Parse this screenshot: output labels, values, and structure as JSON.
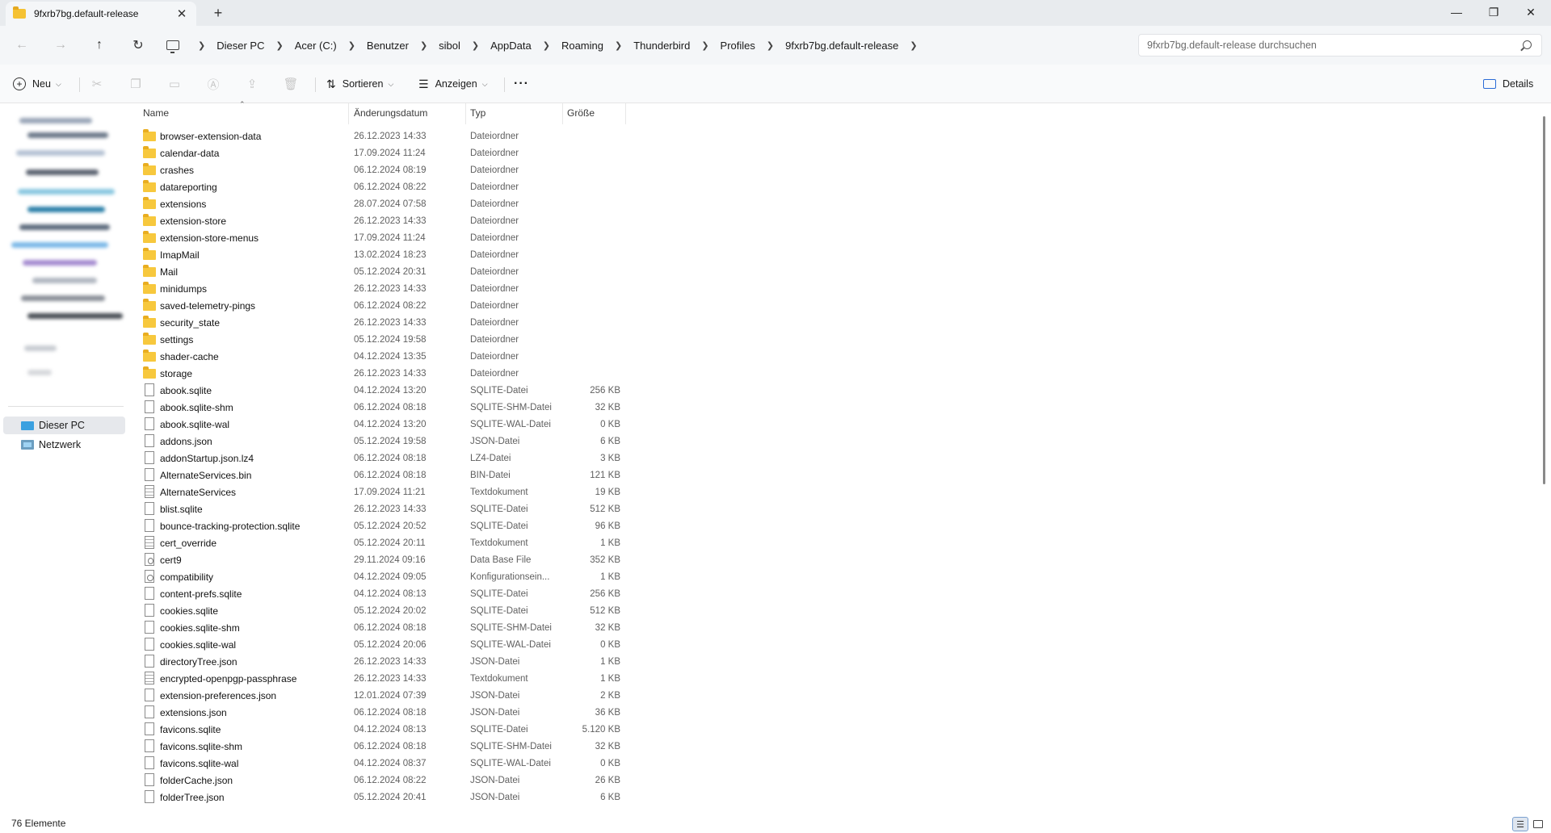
{
  "tab": {
    "title": "9fxrb7bg.default-release",
    "new_tab": "+"
  },
  "window": {
    "minimize": "—",
    "maximize": "❐",
    "close": "✕"
  },
  "nav": {
    "back": "←",
    "forward": "→",
    "up": "↑",
    "refresh": "↻"
  },
  "breadcrumbs": [
    "Dieser PC",
    "Acer (C:)",
    "Benutzer",
    "sibol",
    "AppData",
    "Roaming",
    "Thunderbird",
    "Profiles",
    "9fxrb7bg.default-release"
  ],
  "search": {
    "placeholder": "9fxrb7bg.default-release durchsuchen"
  },
  "toolbar": {
    "new_label": "Neu",
    "sort_label": "Sortieren",
    "view_label": "Anzeigen",
    "more_label": "···",
    "details_label": "Details",
    "icons": [
      "cut-icon",
      "copy-icon",
      "paste-icon",
      "rename-icon",
      "share-icon",
      "delete-icon"
    ]
  },
  "sidebar": {
    "items": [
      {
        "label": "Dieser PC",
        "icon": "computer-icon",
        "selected": true
      },
      {
        "label": "Netzwerk",
        "icon": "network-icon",
        "selected": false
      }
    ]
  },
  "columns": {
    "name": "Name",
    "date": "Änderungsdatum",
    "type": "Typ",
    "size": "Größe"
  },
  "files": [
    {
      "kind": "folder",
      "name": "browser-extension-data",
      "date": "26.12.2023 14:33",
      "type": "Dateiordner",
      "size": ""
    },
    {
      "kind": "folder",
      "name": "calendar-data",
      "date": "17.09.2024 11:24",
      "type": "Dateiordner",
      "size": ""
    },
    {
      "kind": "folder",
      "name": "crashes",
      "date": "06.12.2024 08:19",
      "type": "Dateiordner",
      "size": ""
    },
    {
      "kind": "folder",
      "name": "datareporting",
      "date": "06.12.2024 08:22",
      "type": "Dateiordner",
      "size": ""
    },
    {
      "kind": "folder",
      "name": "extensions",
      "date": "28.07.2024 07:58",
      "type": "Dateiordner",
      "size": ""
    },
    {
      "kind": "folder",
      "name": "extension-store",
      "date": "26.12.2023 14:33",
      "type": "Dateiordner",
      "size": ""
    },
    {
      "kind": "folder",
      "name": "extension-store-menus",
      "date": "17.09.2024 11:24",
      "type": "Dateiordner",
      "size": ""
    },
    {
      "kind": "folder",
      "name": "ImapMail",
      "date": "13.02.2024 18:23",
      "type": "Dateiordner",
      "size": ""
    },
    {
      "kind": "folder",
      "name": "Mail",
      "date": "05.12.2024 20:31",
      "type": "Dateiordner",
      "size": ""
    },
    {
      "kind": "folder",
      "name": "minidumps",
      "date": "26.12.2023 14:33",
      "type": "Dateiordner",
      "size": ""
    },
    {
      "kind": "folder",
      "name": "saved-telemetry-pings",
      "date": "06.12.2024 08:22",
      "type": "Dateiordner",
      "size": ""
    },
    {
      "kind": "folder",
      "name": "security_state",
      "date": "26.12.2023 14:33",
      "type": "Dateiordner",
      "size": ""
    },
    {
      "kind": "folder",
      "name": "settings",
      "date": "05.12.2024 19:58",
      "type": "Dateiordner",
      "size": ""
    },
    {
      "kind": "folder",
      "name": "shader-cache",
      "date": "04.12.2024 13:35",
      "type": "Dateiordner",
      "size": ""
    },
    {
      "kind": "folder",
      "name": "storage",
      "date": "26.12.2023 14:33",
      "type": "Dateiordner",
      "size": ""
    },
    {
      "kind": "file",
      "name": "abook.sqlite",
      "date": "04.12.2024 13:20",
      "type": "SQLITE-Datei",
      "size": "256 KB"
    },
    {
      "kind": "file",
      "name": "abook.sqlite-shm",
      "date": "06.12.2024 08:18",
      "type": "SQLITE-SHM-Datei",
      "size": "32 KB"
    },
    {
      "kind": "file",
      "name": "abook.sqlite-wal",
      "date": "04.12.2024 13:20",
      "type": "SQLITE-WAL-Datei",
      "size": "0 KB"
    },
    {
      "kind": "file",
      "name": "addons.json",
      "date": "05.12.2024 19:58",
      "type": "JSON-Datei",
      "size": "6 KB"
    },
    {
      "kind": "file",
      "name": "addonStartup.json.lz4",
      "date": "06.12.2024 08:18",
      "type": "LZ4-Datei",
      "size": "3 KB"
    },
    {
      "kind": "file",
      "name": "AlternateServices.bin",
      "date": "06.12.2024 08:18",
      "type": "BIN-Datei",
      "size": "121 KB"
    },
    {
      "kind": "text",
      "name": "AlternateServices",
      "date": "17.09.2024 11:21",
      "type": "Textdokument",
      "size": "19 KB"
    },
    {
      "kind": "file",
      "name": "blist.sqlite",
      "date": "26.12.2023 14:33",
      "type": "SQLITE-Datei",
      "size": "512 KB"
    },
    {
      "kind": "file",
      "name": "bounce-tracking-protection.sqlite",
      "date": "05.12.2024 20:52",
      "type": "SQLITE-Datei",
      "size": "96 KB"
    },
    {
      "kind": "text",
      "name": "cert_override",
      "date": "05.12.2024 20:11",
      "type": "Textdokument",
      "size": "1 KB"
    },
    {
      "kind": "db",
      "name": "cert9",
      "date": "29.11.2024 09:16",
      "type": "Data Base File",
      "size": "352 KB"
    },
    {
      "kind": "cfg",
      "name": "compatibility",
      "date": "04.12.2024 09:05",
      "type": "Konfigurationsein...",
      "size": "1 KB"
    },
    {
      "kind": "file",
      "name": "content-prefs.sqlite",
      "date": "04.12.2024 08:13",
      "type": "SQLITE-Datei",
      "size": "256 KB"
    },
    {
      "kind": "file",
      "name": "cookies.sqlite",
      "date": "05.12.2024 20:02",
      "type": "SQLITE-Datei",
      "size": "512 KB"
    },
    {
      "kind": "file",
      "name": "cookies.sqlite-shm",
      "date": "06.12.2024 08:18",
      "type": "SQLITE-SHM-Datei",
      "size": "32 KB"
    },
    {
      "kind": "file",
      "name": "cookies.sqlite-wal",
      "date": "05.12.2024 20:06",
      "type": "SQLITE-WAL-Datei",
      "size": "0 KB"
    },
    {
      "kind": "file",
      "name": "directoryTree.json",
      "date": "26.12.2023 14:33",
      "type": "JSON-Datei",
      "size": "1 KB"
    },
    {
      "kind": "text",
      "name": "encrypted-openpgp-passphrase",
      "date": "26.12.2023 14:33",
      "type": "Textdokument",
      "size": "1 KB"
    },
    {
      "kind": "file",
      "name": "extension-preferences.json",
      "date": "12.01.2024 07:39",
      "type": "JSON-Datei",
      "size": "2 KB"
    },
    {
      "kind": "file",
      "name": "extensions.json",
      "date": "06.12.2024 08:18",
      "type": "JSON-Datei",
      "size": "36 KB"
    },
    {
      "kind": "file",
      "name": "favicons.sqlite",
      "date": "04.12.2024 08:13",
      "type": "SQLITE-Datei",
      "size": "5.120 KB"
    },
    {
      "kind": "file",
      "name": "favicons.sqlite-shm",
      "date": "06.12.2024 08:18",
      "type": "SQLITE-SHM-Datei",
      "size": "32 KB"
    },
    {
      "kind": "file",
      "name": "favicons.sqlite-wal",
      "date": "04.12.2024 08:37",
      "type": "SQLITE-WAL-Datei",
      "size": "0 KB"
    },
    {
      "kind": "file",
      "name": "folderCache.json",
      "date": "06.12.2024 08:22",
      "type": "JSON-Datei",
      "size": "26 KB"
    },
    {
      "kind": "file",
      "name": "folderTree.json",
      "date": "05.12.2024 20:41",
      "type": "JSON-Datei",
      "size": "6 KB"
    }
  ],
  "status": {
    "count": "76 Elemente"
  }
}
